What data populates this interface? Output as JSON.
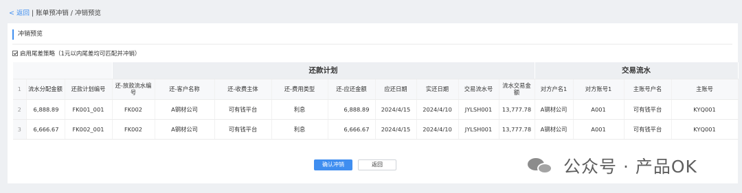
{
  "breadcrumb": {
    "back": "< 返回",
    "separator": "|",
    "path": "账单预冲销 / 冲销预览"
  },
  "panel": {
    "title": "冲销预览",
    "strategy_label": "启用尾差策略（1元以内尾差均可匹配并冲销）",
    "strategy_checked": true
  },
  "table": {
    "group_repay": "还款计划",
    "group_flow": "交易流水",
    "header_rownum": "1",
    "columns": [
      "流水分配金额",
      "还款计划编号",
      "还-放款流水编号",
      "还-客户名称",
      "还-收费主体",
      "还-费用类型",
      "还-应还金额",
      "应还日期",
      "实还日期",
      "交易流水号",
      "流水交易金额",
      "对方户名1",
      "对方账号1",
      "主账号户名",
      "主账号"
    ],
    "rows": [
      {
        "no": "2",
        "cells": [
          "6,888.89",
          "FK001_001",
          "FK002",
          "A钢材公司",
          "可有钱平台",
          "利息",
          "6,888.89",
          "2024/4/15",
          "2024/4/10",
          "JYLSH001",
          "13,777.78",
          "A钢材公司",
          "A001",
          "可有钱平台",
          "KYQ001"
        ]
      },
      {
        "no": "3",
        "cells": [
          "6,666.67",
          "FK002_001",
          "FK002",
          "A钢材公司",
          "可有钱平台",
          "利息",
          "6,666.67",
          "2024/4/15",
          "2024/4/10",
          "JYLSH001",
          "13,777.78",
          "A钢材公司",
          "A001",
          "可有钱平台",
          "KYQ001"
        ]
      }
    ]
  },
  "buttons": {
    "confirm": "确认冲销",
    "back": "返回"
  },
  "watermark": {
    "text": "公众号 · 产品OK",
    "icon": "wechat-icon"
  },
  "colors": {
    "accent": "#3f8ef0",
    "page_bg": "#eef0f3",
    "group_header_bg": "#edeff2"
  }
}
